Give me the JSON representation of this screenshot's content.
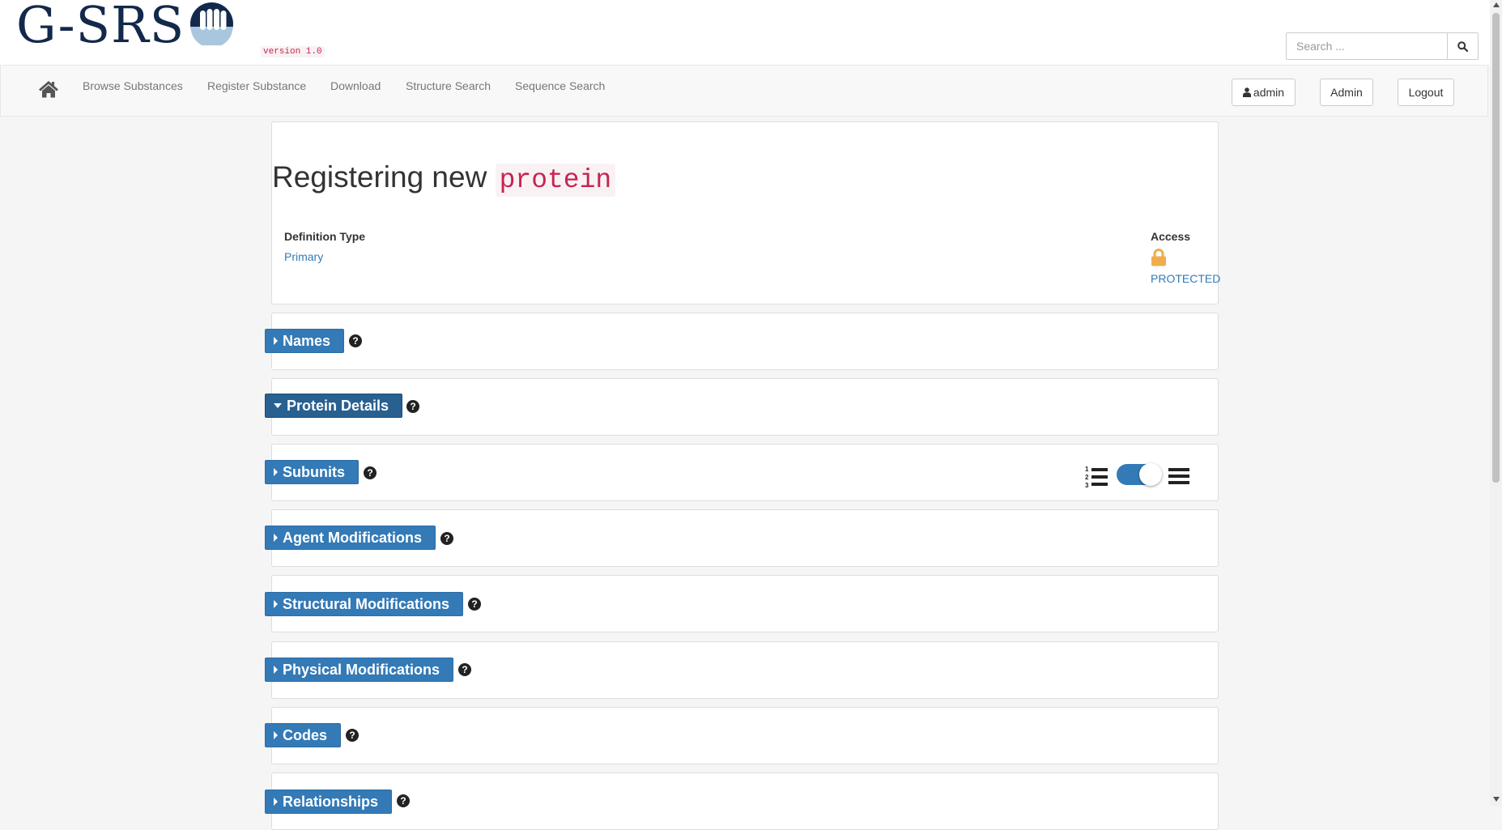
{
  "brand": {
    "logo_text": "G-SRS",
    "version": "version 1.0"
  },
  "search": {
    "placeholder": "Search ..."
  },
  "nav": {
    "links": [
      "Browse Substances",
      "Register Substance",
      "Download",
      "Structure Search",
      "Sequence Search"
    ],
    "user_button": "admin",
    "admin_button": "Admin",
    "logout_button": "Logout"
  },
  "page": {
    "title_prefix": "Registering new",
    "title_code": "protein",
    "definition_type_label": "Definition Type",
    "definition_type_value": "Primary",
    "access_label": "Access",
    "access_value": "PROTECTED"
  },
  "sections": [
    {
      "label": "Names",
      "expanded": false
    },
    {
      "label": "Protein Details",
      "expanded": true
    },
    {
      "label": "Subunits",
      "expanded": false
    },
    {
      "label": "Agent Modifications",
      "expanded": false
    },
    {
      "label": "Structural Modifications",
      "expanded": false
    },
    {
      "label": "Physical Modifications",
      "expanded": false
    },
    {
      "label": "Codes",
      "expanded": false
    },
    {
      "label": "Relationships",
      "expanded": false
    }
  ],
  "subunits_view_toggle": {
    "on": true
  },
  "colors": {
    "primary": "#337ab7",
    "brand_navy": "#13294b",
    "lock": "#f0ad4e",
    "code_red": "#c7254e"
  },
  "icons": [
    "home-icon",
    "search-icon",
    "user-icon",
    "lock-icon",
    "help-icon",
    "numbered-list-icon",
    "list-icon",
    "caret-right-icon",
    "caret-down-icon"
  ]
}
